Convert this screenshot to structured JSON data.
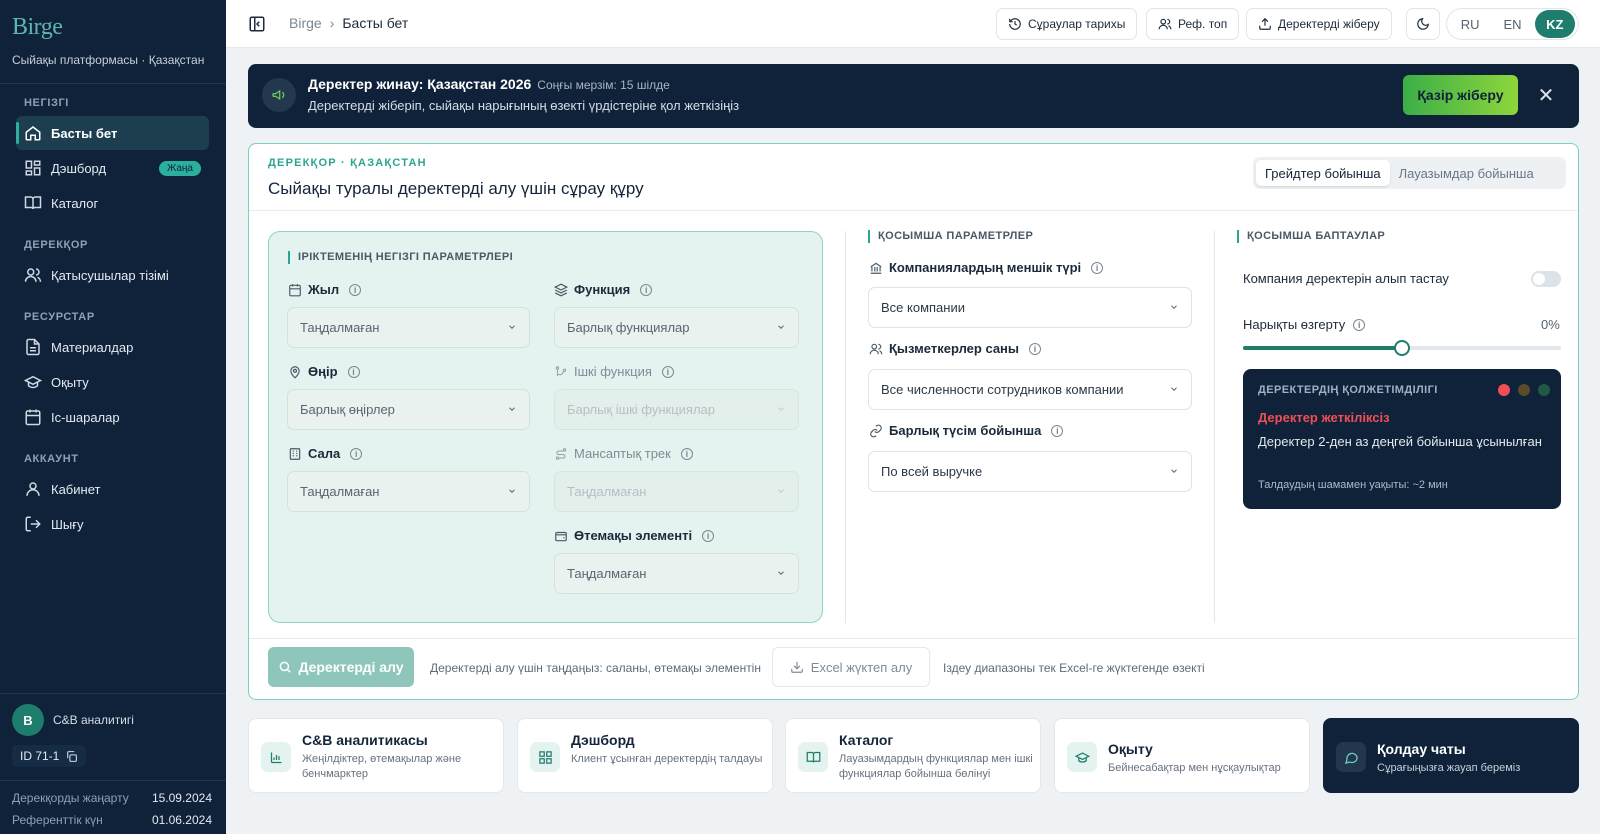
{
  "app": {
    "logo": "Birge",
    "subtitle": "Сыйақы платформасы · Қазақстан"
  },
  "sidebar": {
    "sections": {
      "main": "НЕГІЗГІ",
      "db": "ДЕРЕКҚОР",
      "res": "РЕСУРСТАР",
      "acc": "АККАУНТ"
    },
    "items": {
      "home": "Басты бет",
      "dashboard": "Дэшборд",
      "dashboard_badge": "Жаңа",
      "catalog": "Каталог",
      "participants": "Қатысушылар тізімі",
      "materials": "Материалдар",
      "training": "Оқыту",
      "events": "Іс-шаралар",
      "cabinet": "Кабинет",
      "logout": "Шығу"
    },
    "user": {
      "initial": "B",
      "role": "C&B аналитигі",
      "id": "ID 71-1"
    },
    "meta": {
      "update_label": "Дерекқорды жаңарту",
      "update_value": "15.09.2024",
      "ref_label": "Референттік күн",
      "ref_value": "01.06.2024"
    }
  },
  "topbar": {
    "breadcrumb_root": "Birge",
    "breadcrumb_current": "Басты бет",
    "history": "Сұраулар тарихы",
    "ref_group": "Реф. топ",
    "send_data": "Деректерді жіберу",
    "langs": [
      "RU",
      "EN",
      "KZ"
    ],
    "active_lang": "KZ"
  },
  "banner": {
    "title": "Деректер жинау: Қазақстан 2026",
    "deadline": "Соңғы мерзім: 15 шілде",
    "subtitle": "Деректерді жіберіп, сыйақы нарығының өзекті үрдістеріне қол жеткізіңіз",
    "cta": "Қазір жіберу"
  },
  "card": {
    "kicker": "ДЕРЕКҚОР · ҚАЗАҚСТАН",
    "title": "Сыйақы туралы деректерді алу үшін сұрау құру",
    "seg_grade": "Грейдтер бойынша",
    "seg_position": "Лауазымдар бойынша"
  },
  "basic": {
    "heading": "ІРІКТЕМЕНІҢ НЕГІЗГІ ПАРАМЕТРЛЕРІ",
    "year_label": "Жыл",
    "year_value": "Таңдалмаған",
    "function_label": "Функция",
    "function_value": "Барлық функциялар",
    "region_label": "Өңір",
    "region_value": "Барлық өңірлер",
    "subfunction_label": "Ішкі функция",
    "subfunction_value": "Барлық ішкі функциялар",
    "industry_label": "Сала",
    "industry_value": "Таңдалмаған",
    "career_label": "Мансаптық трек",
    "career_value": "Таңдалмаған",
    "comp_label": "Өтемақы элементі",
    "comp_value": "Таңдалмаған"
  },
  "extra": {
    "heading": "ҚОСЫМША ПАРАМЕТРЛЕР",
    "ownership_label": "Компаниялардың меншік түрі",
    "ownership_value": "Все компании",
    "headcount_label": "Қызметкерлер саны",
    "headcount_value": "Все численности сотрудников компании",
    "revenue_label": "Барлық түсім бойынша",
    "revenue_value": "По всей выручке"
  },
  "settings": {
    "heading": "ҚОСЫМША БАПТАУЛАР",
    "exclude_label": "Компания деректерін алып тастау",
    "exclude_on": false,
    "market_label": "Нарықты өзгерту",
    "market_value": "0%",
    "market_slider_fraction": 0.5
  },
  "availability": {
    "heading": "ДЕРЕКТЕРДІҢ ҚОЛЖЕТІМДІЛІГІ",
    "status": "Деректер жеткіліксіз",
    "description": "Деректер 2-ден аз деңгей бойынша ұсынылған",
    "time": "Талдаудың шамамен уақыты: ~2 мин",
    "colors": {
      "red": "#f04e55",
      "amber": "#5b4a2c",
      "green": "#1f5a45"
    }
  },
  "actions": {
    "get_data": "Деректерді алу",
    "get_hint": "Деректерді алу үшін таңдаңыз: саланы, өтемақы элементін",
    "excel": "Excel жүктеп алу",
    "excel_hint": "Іздеу диапазоны тек Excel-ге жүктегенде өзекті"
  },
  "tiles": [
    {
      "title": "C&B аналитикасы",
      "desc": "Жеңілдіктер, өтемақылар және бенчмарктер",
      "icon": "bar-chart-icon"
    },
    {
      "title": "Дэшборд",
      "desc": "Клиент ұсынған деректердің талдауы",
      "icon": "grid-icon"
    },
    {
      "title": "Каталог",
      "desc": "Лауазымдардың функциялар мен ішкі функциялар бойынша бөлінуі",
      "icon": "book-icon"
    },
    {
      "title": "Оқыту",
      "desc": "Бейнесабақтар мен нұсқаулықтар",
      "icon": "graduation-cap-icon"
    },
    {
      "title": "Қолдау чаты",
      "desc": "Сұрағыңызға жауап береміз",
      "icon": "chat-icon"
    }
  ],
  "colors": {
    "accent": "#1f7d6e",
    "navy": "#0f2239",
    "cta": "#43b045"
  }
}
